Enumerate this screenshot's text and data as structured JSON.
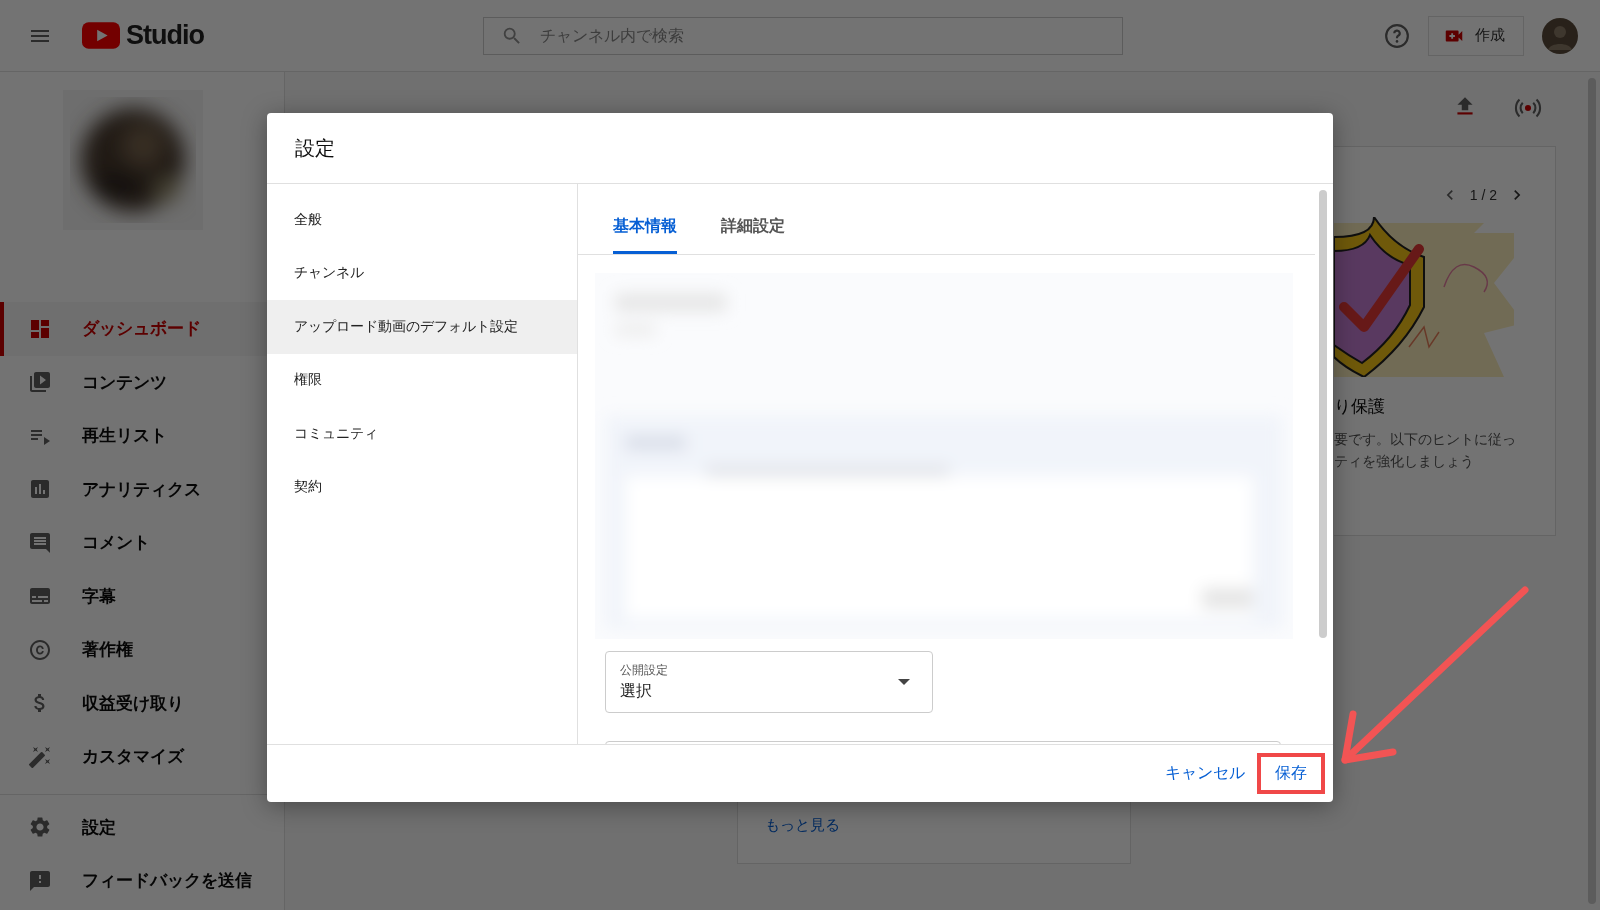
{
  "header": {
    "logo_text": "Studio",
    "search": {
      "placeholder": "チャンネル内で検索"
    },
    "create_button": "作成"
  },
  "sidebar": {
    "items": [
      {
        "label": "ダッシュボード",
        "selected": true
      },
      {
        "label": "コンテンツ",
        "selected": false
      },
      {
        "label": "再生リスト",
        "selected": false
      },
      {
        "label": "アナリティクス",
        "selected": false
      },
      {
        "label": "コメント",
        "selected": false
      },
      {
        "label": "字幕",
        "selected": false
      },
      {
        "label": "著作権",
        "selected": false
      },
      {
        "label": "収益受け取り",
        "selected": false
      },
      {
        "label": "カスタマイズ",
        "selected": false
      }
    ],
    "footer_items": [
      {
        "label": "設定",
        "selected": false
      },
      {
        "label": "フィードバックを送信",
        "selected": false
      }
    ]
  },
  "page": {
    "tip_card": {
      "pager": "1 / 2",
      "title": "り保護",
      "body_lines": [
        "要です。以下のヒントに従っ",
        "ティを強化しましょう"
      ]
    },
    "more_link": "もっと見る"
  },
  "dialog": {
    "title": "設定",
    "nav": [
      {
        "label": "全般",
        "selected": false
      },
      {
        "label": "チャンネル",
        "selected": false
      },
      {
        "label": "アップロード動画のデフォルト設定",
        "selected": true
      },
      {
        "label": "権限",
        "selected": false
      },
      {
        "label": "コミュニティ",
        "selected": false
      },
      {
        "label": "契約",
        "selected": false
      }
    ],
    "tabs": [
      {
        "label": "基本情報",
        "selected": true
      },
      {
        "label": "詳細設定",
        "selected": false
      }
    ],
    "visibility_select": {
      "label": "公開設定",
      "value": "選択"
    },
    "cancel_button": "キャンセル",
    "save_button": "保存"
  }
}
